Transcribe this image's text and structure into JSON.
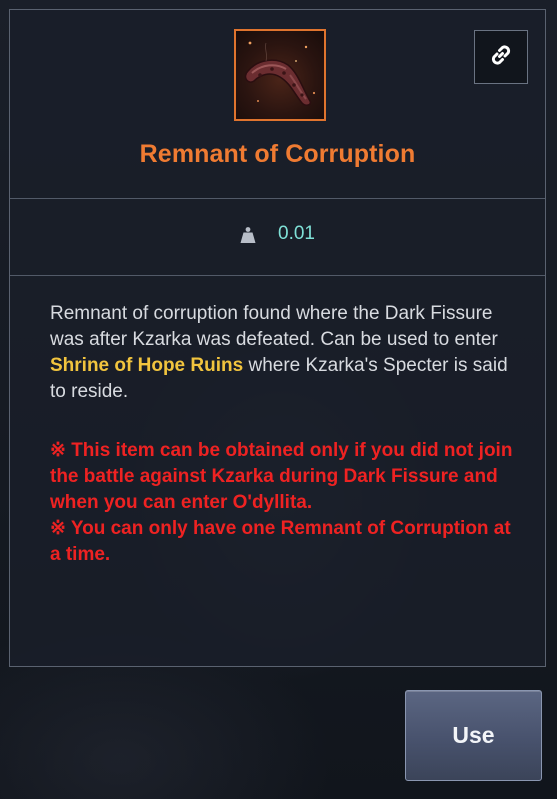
{
  "item": {
    "name": "Remnant of Corruption",
    "icon": "corrupted-remnant-icon",
    "rarity_color": "#ef7b32"
  },
  "actions": {
    "link_icon": "link-icon",
    "use_label": "Use"
  },
  "weight": {
    "icon": "weight-icon",
    "value": "0.01"
  },
  "description": {
    "part1": "Remnant of corruption found where the Dark Fissure was after Kzarka was defeated. Can be used to enter ",
    "highlight": "Shrine of Hope Ruins",
    "part2": " where Kzarka's Specter is said to reside."
  },
  "notes": [
    "※ This item can be obtained only if you did not join the battle against Kzarka during Dark Fissure and when you can enter O'dyllita.",
    "※ You can only have one Remnant of Corruption at a time."
  ],
  "colors": {
    "highlight": "#f1c43e",
    "warning": "#ee2222",
    "weight_value": "#7fe1d7"
  }
}
